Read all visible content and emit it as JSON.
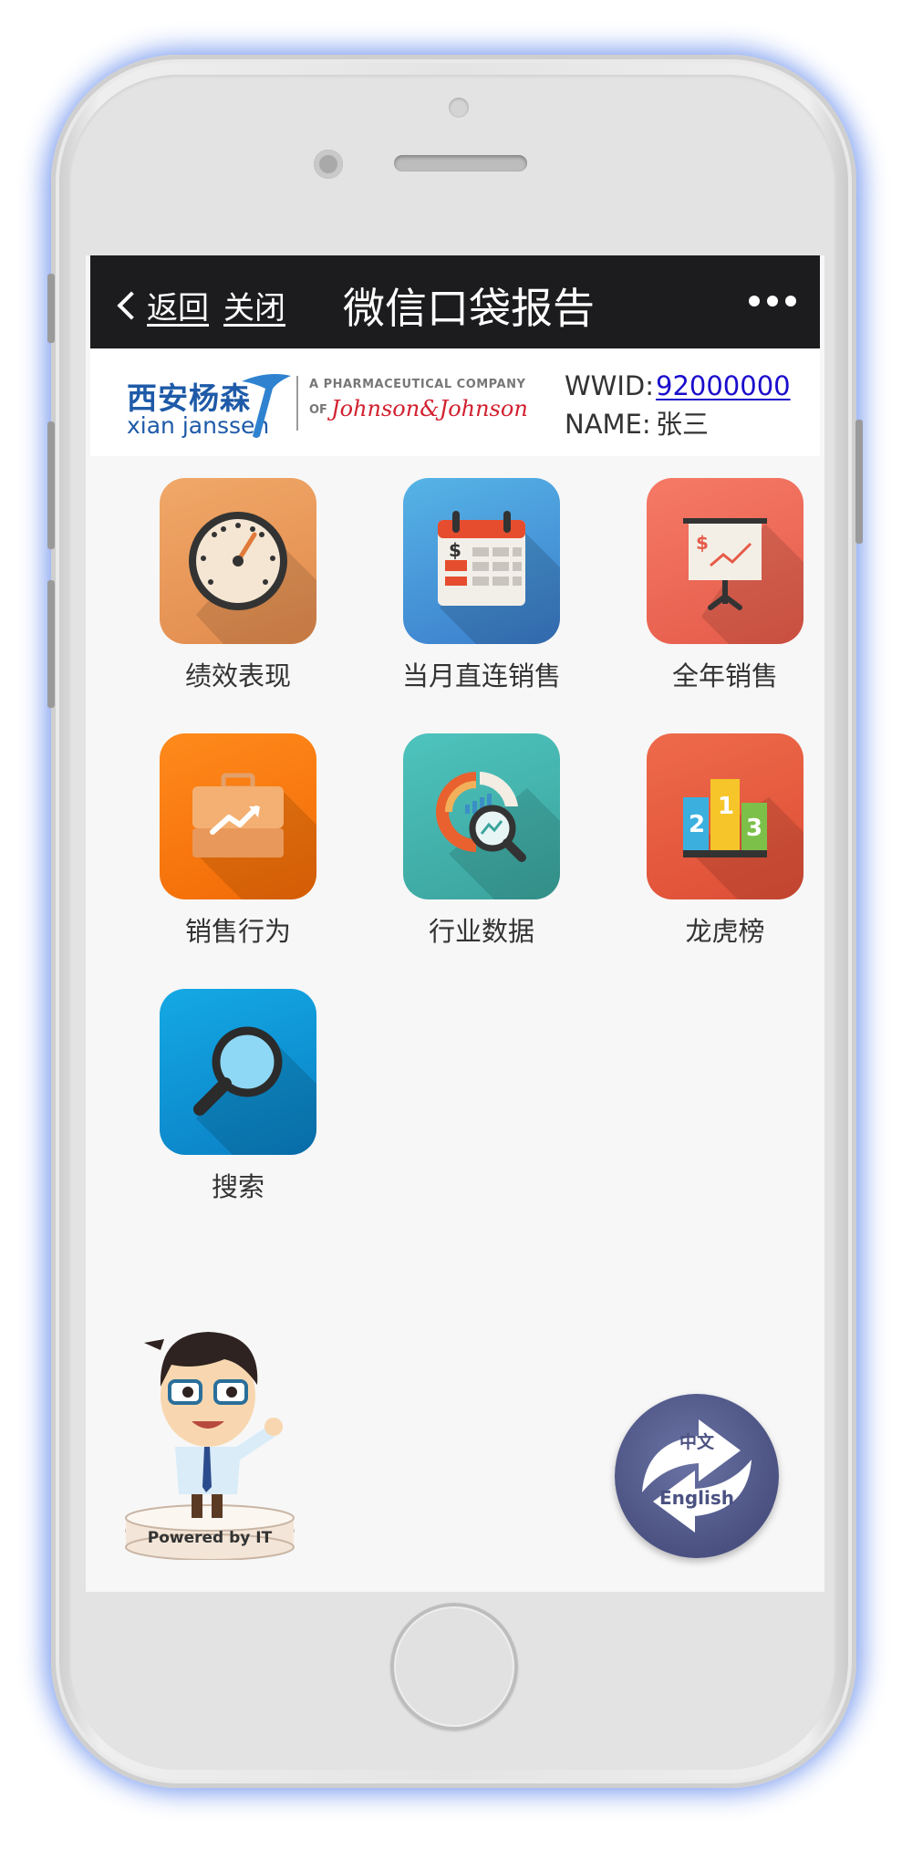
{
  "navbar": {
    "back_label": "返回",
    "close_label": "关闭",
    "title": "微信口袋报告"
  },
  "header": {
    "logo_cn": "西安杨森",
    "logo_en": "xian janssen",
    "logo_tagline": "A PHARMACEUTICAL COMPANY",
    "logo_of": "OF",
    "logo_parent": "Johnson&Johnson",
    "wwid_label": "WWID:",
    "wwid_value": "92000000",
    "name_label": "NAME:",
    "name_value": "张三"
  },
  "tiles": [
    {
      "label": "绩效表现",
      "icon": "speedometer-icon",
      "color": "#e8965a"
    },
    {
      "label": "当月直连销售",
      "icon": "calendar-icon",
      "color": "#3f8fd6"
    },
    {
      "label": "全年销售",
      "icon": "presentation-chart-icon",
      "color": "#ec6a57"
    },
    {
      "label": "销售行为",
      "icon": "briefcase-icon",
      "color": "#f27a10"
    },
    {
      "label": "行业数据",
      "icon": "chart-magnifier-icon",
      "color": "#46b5ae"
    },
    {
      "label": "龙虎榜",
      "icon": "podium-icon",
      "color": "#e55a3f"
    },
    {
      "label": "搜索",
      "icon": "search-icon",
      "color": "#1b93d6"
    }
  ],
  "footer": {
    "powered_by": "Powered by IT",
    "lang_zh": "中文",
    "lang_en": "English"
  }
}
